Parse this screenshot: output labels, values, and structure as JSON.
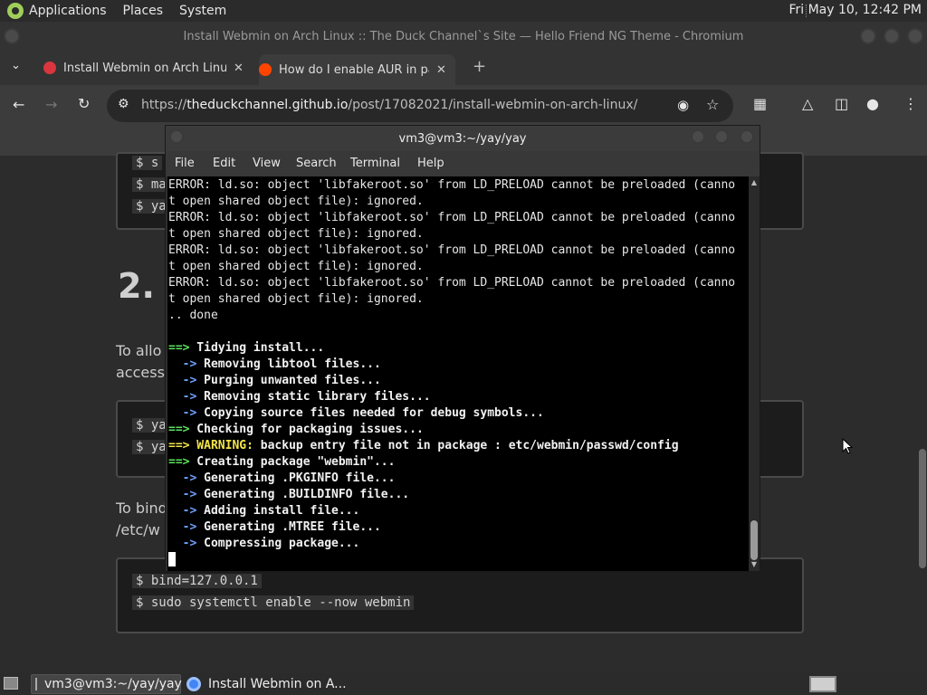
{
  "top_panel": {
    "menus": [
      "Applications",
      "Places",
      "System"
    ],
    "clock": "Fri May 10, 12:42 PM"
  },
  "browser": {
    "window_title": "Install Webmin on Arch Linux :: The Duck Channel`s Site — Hello Friend NG Theme - Chromium",
    "tabs": [
      {
        "label": "Install Webmin on Arch Linux",
        "favicon_color": "#d9363e"
      },
      {
        "label": "How do I enable AUR in pacman",
        "favicon_color": "#ff4500"
      }
    ],
    "url_prefix": "https://",
    "url_host": "theduckchannel.github.io",
    "url_path": "/post/17082021/install-webmin-on-arch-linux/"
  },
  "page": {
    "code_top": [
      "$ s",
      "$ ma",
      "$ ya"
    ],
    "heading": "2.",
    "para1": [
      "To allo",
      "access"
    ],
    "code_mid": [
      "$ ya",
      "$ ya"
    ],
    "para2": [
      "To bind",
      "/etc/w"
    ],
    "code_bottom": [
      "$ bind=127.0.0.1",
      "$ sudo systemctl enable --now webmin"
    ]
  },
  "terminal": {
    "title": "vm3@vm3:~/yay/yay",
    "menu": [
      "File",
      "Edit",
      "View",
      "Search",
      "Terminal",
      "Help"
    ],
    "lines": [
      {
        "parts": [
          {
            "t": "ERROR: ld.so: object 'libfakeroot.so' from LD_PRELOAD cannot be preloaded (canno",
            "c": ""
          }
        ]
      },
      {
        "parts": [
          {
            "t": "t open shared object file): ignored.",
            "c": ""
          }
        ]
      },
      {
        "parts": [
          {
            "t": "ERROR: ld.so: object 'libfakeroot.so' from LD_PRELOAD cannot be preloaded (canno",
            "c": ""
          }
        ]
      },
      {
        "parts": [
          {
            "t": "t open shared object file): ignored.",
            "c": ""
          }
        ]
      },
      {
        "parts": [
          {
            "t": "ERROR: ld.so: object 'libfakeroot.so' from LD_PRELOAD cannot be preloaded (canno",
            "c": ""
          }
        ]
      },
      {
        "parts": [
          {
            "t": "t open shared object file): ignored.",
            "c": ""
          }
        ]
      },
      {
        "parts": [
          {
            "t": "ERROR: ld.so: object 'libfakeroot.so' from LD_PRELOAD cannot be preloaded (canno",
            "c": ""
          }
        ]
      },
      {
        "parts": [
          {
            "t": "t open shared object file): ignored.",
            "c": ""
          }
        ]
      },
      {
        "parts": [
          {
            "t": ".. done",
            "c": ""
          }
        ]
      },
      {
        "parts": [
          {
            "t": "",
            "c": ""
          }
        ]
      },
      {
        "parts": [
          {
            "t": "==>",
            "c": "green"
          },
          {
            "t": " Tidying install...",
            "c": "bold"
          }
        ]
      },
      {
        "parts": [
          {
            "t": "  ->",
            "c": "blue"
          },
          {
            "t": " Removing libtool files...",
            "c": "bold"
          }
        ]
      },
      {
        "parts": [
          {
            "t": "  ->",
            "c": "blue"
          },
          {
            "t": " Purging unwanted files...",
            "c": "bold"
          }
        ]
      },
      {
        "parts": [
          {
            "t": "  ->",
            "c": "blue"
          },
          {
            "t": " Removing static library files...",
            "c": "bold"
          }
        ]
      },
      {
        "parts": [
          {
            "t": "  ->",
            "c": "blue"
          },
          {
            "t": " Copying source files needed for debug symbols...",
            "c": "bold"
          }
        ]
      },
      {
        "parts": [
          {
            "t": "==>",
            "c": "green"
          },
          {
            "t": " Checking for packaging issues...",
            "c": "bold"
          }
        ]
      },
      {
        "parts": [
          {
            "t": "==>",
            "c": "yellow"
          },
          {
            "t": " WARNING:",
            "c": "yellow"
          },
          {
            "t": " backup entry file not in package : etc/webmin/passwd/config",
            "c": "bold"
          }
        ]
      },
      {
        "parts": [
          {
            "t": "==>",
            "c": "green"
          },
          {
            "t": " Creating package \"webmin\"...",
            "c": "bold"
          }
        ]
      },
      {
        "parts": [
          {
            "t": "  ->",
            "c": "blue"
          },
          {
            "t": " Generating .PKGINFO file...",
            "c": "bold"
          }
        ]
      },
      {
        "parts": [
          {
            "t": "  ->",
            "c": "blue"
          },
          {
            "t": " Generating .BUILDINFO file...",
            "c": "bold"
          }
        ]
      },
      {
        "parts": [
          {
            "t": "  ->",
            "c": "blue"
          },
          {
            "t": " Adding install file...",
            "c": "bold"
          }
        ]
      },
      {
        "parts": [
          {
            "t": "  ->",
            "c": "blue"
          },
          {
            "t": " Generating .MTREE file...",
            "c": "bold"
          }
        ]
      },
      {
        "parts": [
          {
            "t": "  ->",
            "c": "blue"
          },
          {
            "t": " Compressing package...",
            "c": "bold"
          }
        ]
      }
    ]
  },
  "taskbar": {
    "items": [
      {
        "label": "vm3@vm3:~/yay/yay",
        "icon": "terminal-icon"
      },
      {
        "label": "Install Webmin on A...",
        "icon": "chromium-icon"
      }
    ]
  }
}
